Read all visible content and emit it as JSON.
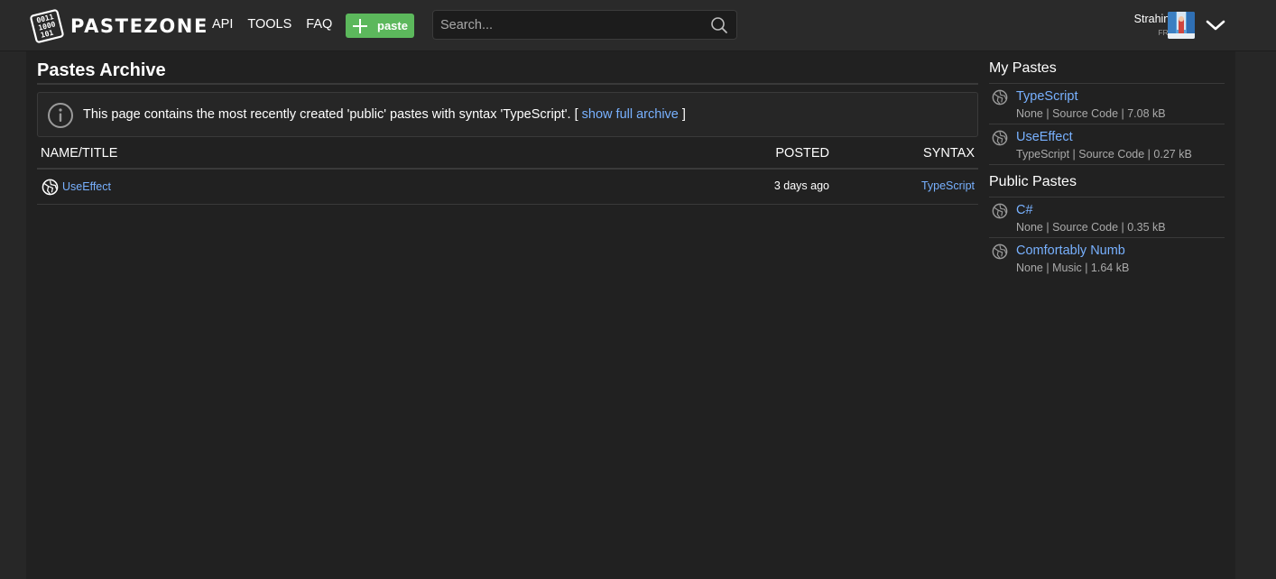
{
  "header": {
    "logo_text": "PASTEZONE",
    "logo_mark_lines": [
      "0011",
      "1000",
      "101"
    ],
    "nav": [
      {
        "label": "API"
      },
      {
        "label": "TOOLS"
      },
      {
        "label": "FAQ"
      }
    ],
    "paste_button": {
      "label": "paste",
      "color": "#5cb85c"
    },
    "search": {
      "placeholder": "Search...",
      "value": ""
    },
    "user": {
      "name": "Strahinja",
      "plan": "FREE"
    }
  },
  "main": {
    "title": "Pastes Archive",
    "notice": {
      "text": "This page contains the most recently created 'public' pastes with syntax 'TypeScript'. [ ",
      "link": "show full archive",
      "text_after": " ]"
    },
    "table": {
      "headers": {
        "name": "NAME/TITLE",
        "posted": "POSTED",
        "syntax": "SYNTAX"
      },
      "rows": [
        {
          "name": "UseEffect",
          "posted": "3 days ago",
          "syntax": "TypeScript"
        }
      ]
    }
  },
  "sidebar": {
    "my_pastes": {
      "heading": "My Pastes",
      "items": [
        {
          "title": "TypeScript",
          "meta": "None | Source Code | 7.08 kB"
        },
        {
          "title": "UseEffect",
          "meta": "TypeScript | Source Code | 0.27 kB"
        }
      ]
    },
    "public_pastes": {
      "heading": "Public Pastes",
      "items": [
        {
          "title": "C#",
          "meta": "None | Source Code | 0.35 kB"
        },
        {
          "title": "Comfortably Numb",
          "meta": "None | Music | 1.64 kB"
        }
      ]
    }
  },
  "colors": {
    "background": "#272727",
    "content_bg": "#212121",
    "link": "#78b1ff",
    "accent_green": "#5cb85c"
  },
  "icons": {
    "logo": "binary-logo-icon",
    "search": "search-icon",
    "info": "info-icon",
    "globe": "globe-icon",
    "chevron": "chevron-down-icon"
  }
}
